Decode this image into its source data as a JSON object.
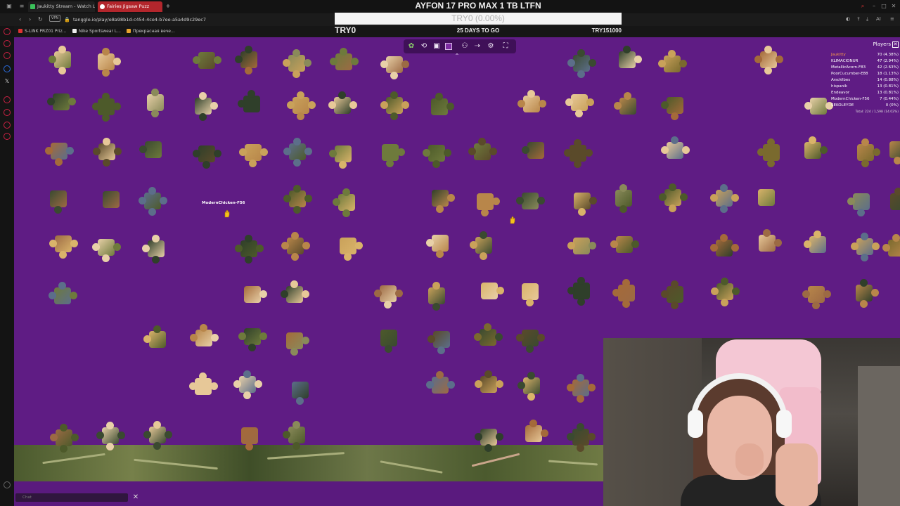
{
  "browser": {
    "tabs": [
      {
        "label": "Jaukitty Stream - Watch Li",
        "favicon_color": "#3ac15a"
      },
      {
        "label": "Fairies Jigsaw Puzz",
        "favicon_color": "#ffffff"
      }
    ],
    "url": "tanggle.io/play/e8a98b1d-c454-4ce4-b7ee-a5a4d9c29ec7",
    "vpn_label": "VPN",
    "bookmarks": [
      "S-LINK PRZ01 Priz...",
      "Nike Sportswear L...",
      "Прекрасная вече..."
    ]
  },
  "overlay": {
    "title": "AYFON 17 PRO MAX 1 TB LTFN",
    "progress_text": "TRY0 (0.00%)",
    "progress_value": 0,
    "left_amount": "TRY0",
    "countdown": "25 DAYS TO GO",
    "goal": "TRY151000"
  },
  "game": {
    "cursor_user": "ModernChicken-F56",
    "players_title": "Players",
    "players": [
      {
        "name": "Jaukitty",
        "score": "70 (4.38%)",
        "color": "#ff9d47"
      },
      {
        "name": "KLIMACIONUR",
        "score": "47 (2.94%)",
        "color": "#ffffff"
      },
      {
        "name": "MetallicAcorn-F83",
        "score": "42 (2.63%)",
        "color": "#ffffff"
      },
      {
        "name": "PoorCucumber-E88",
        "score": "18 (1.13%)",
        "color": "#ffffff"
      },
      {
        "name": "ArsoVibes",
        "score": "14 (0.88%)",
        "color": "#ffffff"
      },
      {
        "name": "hispanik",
        "score": "13 (0.81%)",
        "color": "#ffffff"
      },
      {
        "name": "Endeavor",
        "score": "13 (0.81%)",
        "color": "#ffffff"
      },
      {
        "name": "ModernChicken-F56",
        "score": "7 (0.44%)",
        "color": "#ffffff"
      },
      {
        "name": "SEKOLEYDE",
        "score": "0 (0%)",
        "color": "#ffffff"
      }
    ],
    "total": "Total: 224 / 1,598 (14.02%)",
    "chat_placeholder": "Chat"
  },
  "colors": {
    "canvas": "#5f1c84",
    "tab_active": "#b3262c",
    "progress_bar": "#f4f4f4"
  }
}
